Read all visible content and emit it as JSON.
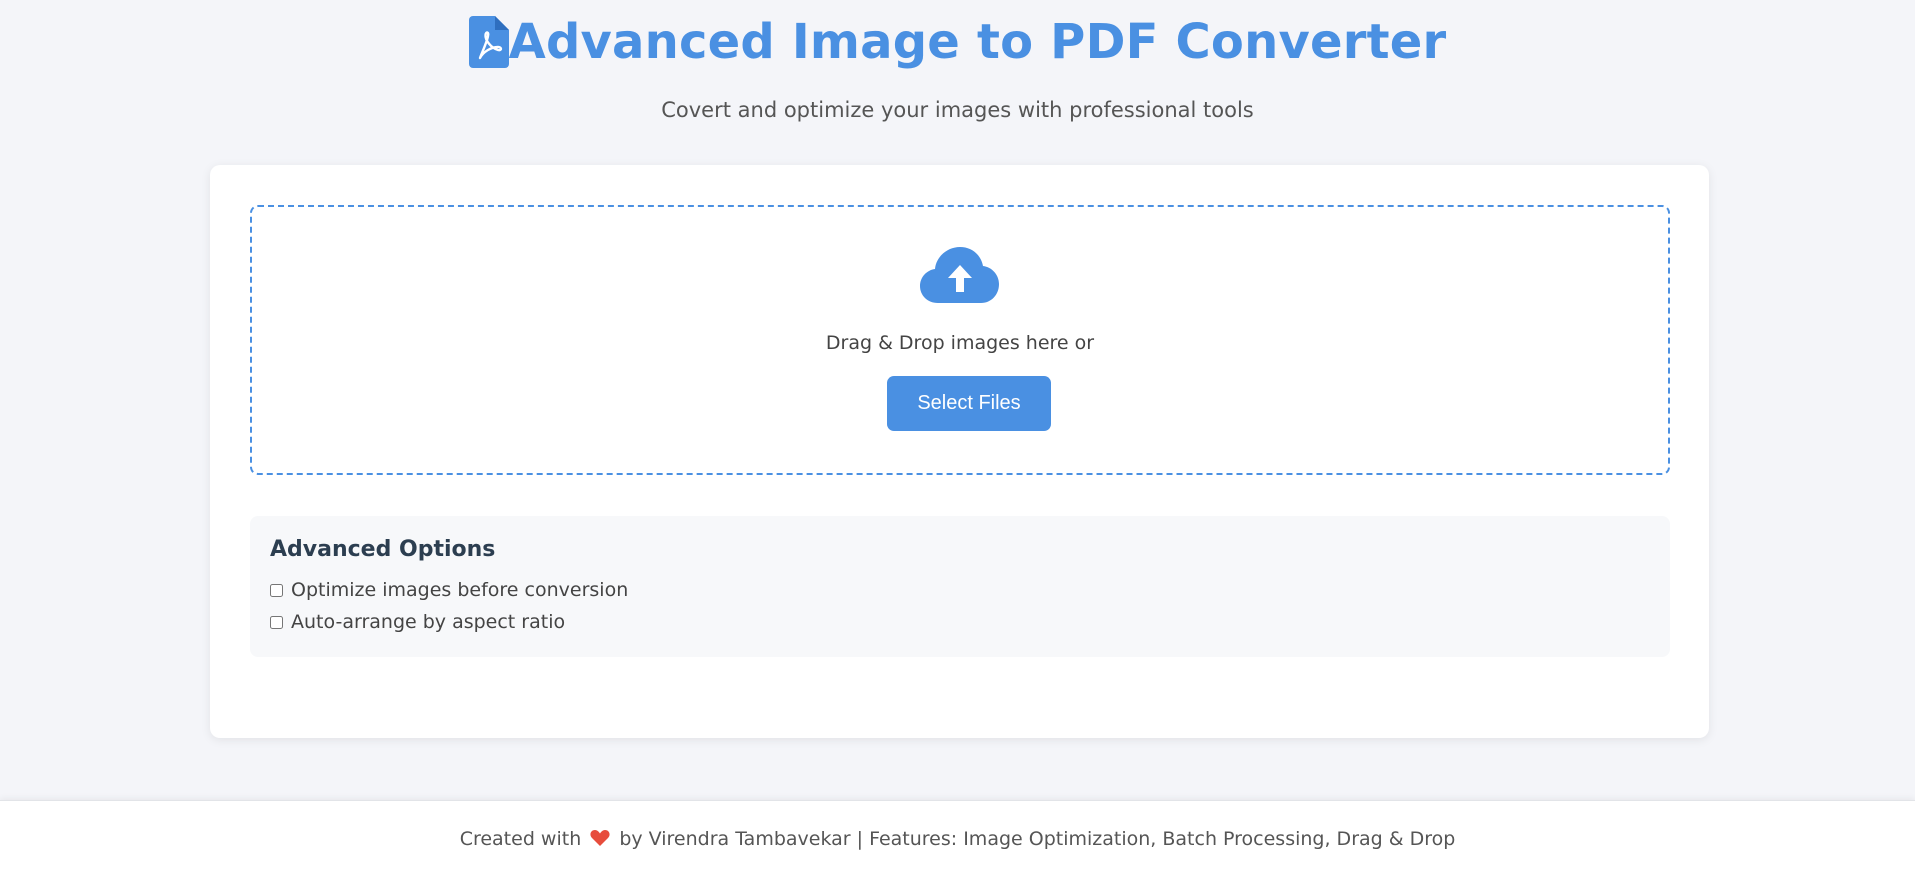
{
  "header": {
    "title": "Advanced Image to PDF Converter",
    "subtitle": "Covert and optimize your images with professional tools",
    "icon": "file-pdf-icon"
  },
  "upload": {
    "icon": "cloud-upload-icon",
    "drop_text": "Drag & Drop images here or",
    "select_button": "Select Files"
  },
  "options": {
    "heading": "Advanced Options",
    "items": [
      {
        "label": "Optimize images before conversion",
        "checked": false
      },
      {
        "label": "Auto-arrange by aspect ratio",
        "checked": false
      }
    ]
  },
  "footer": {
    "prefix": "Created with",
    "heart_icon": "heart-icon",
    "suffix": "by Virendra Tambavekar | Features: Image Optimization, Batch Processing, Drag & Drop"
  },
  "colors": {
    "accent": "#4a90e2",
    "heart": "#e74c3c",
    "background": "#f4f5f9"
  }
}
